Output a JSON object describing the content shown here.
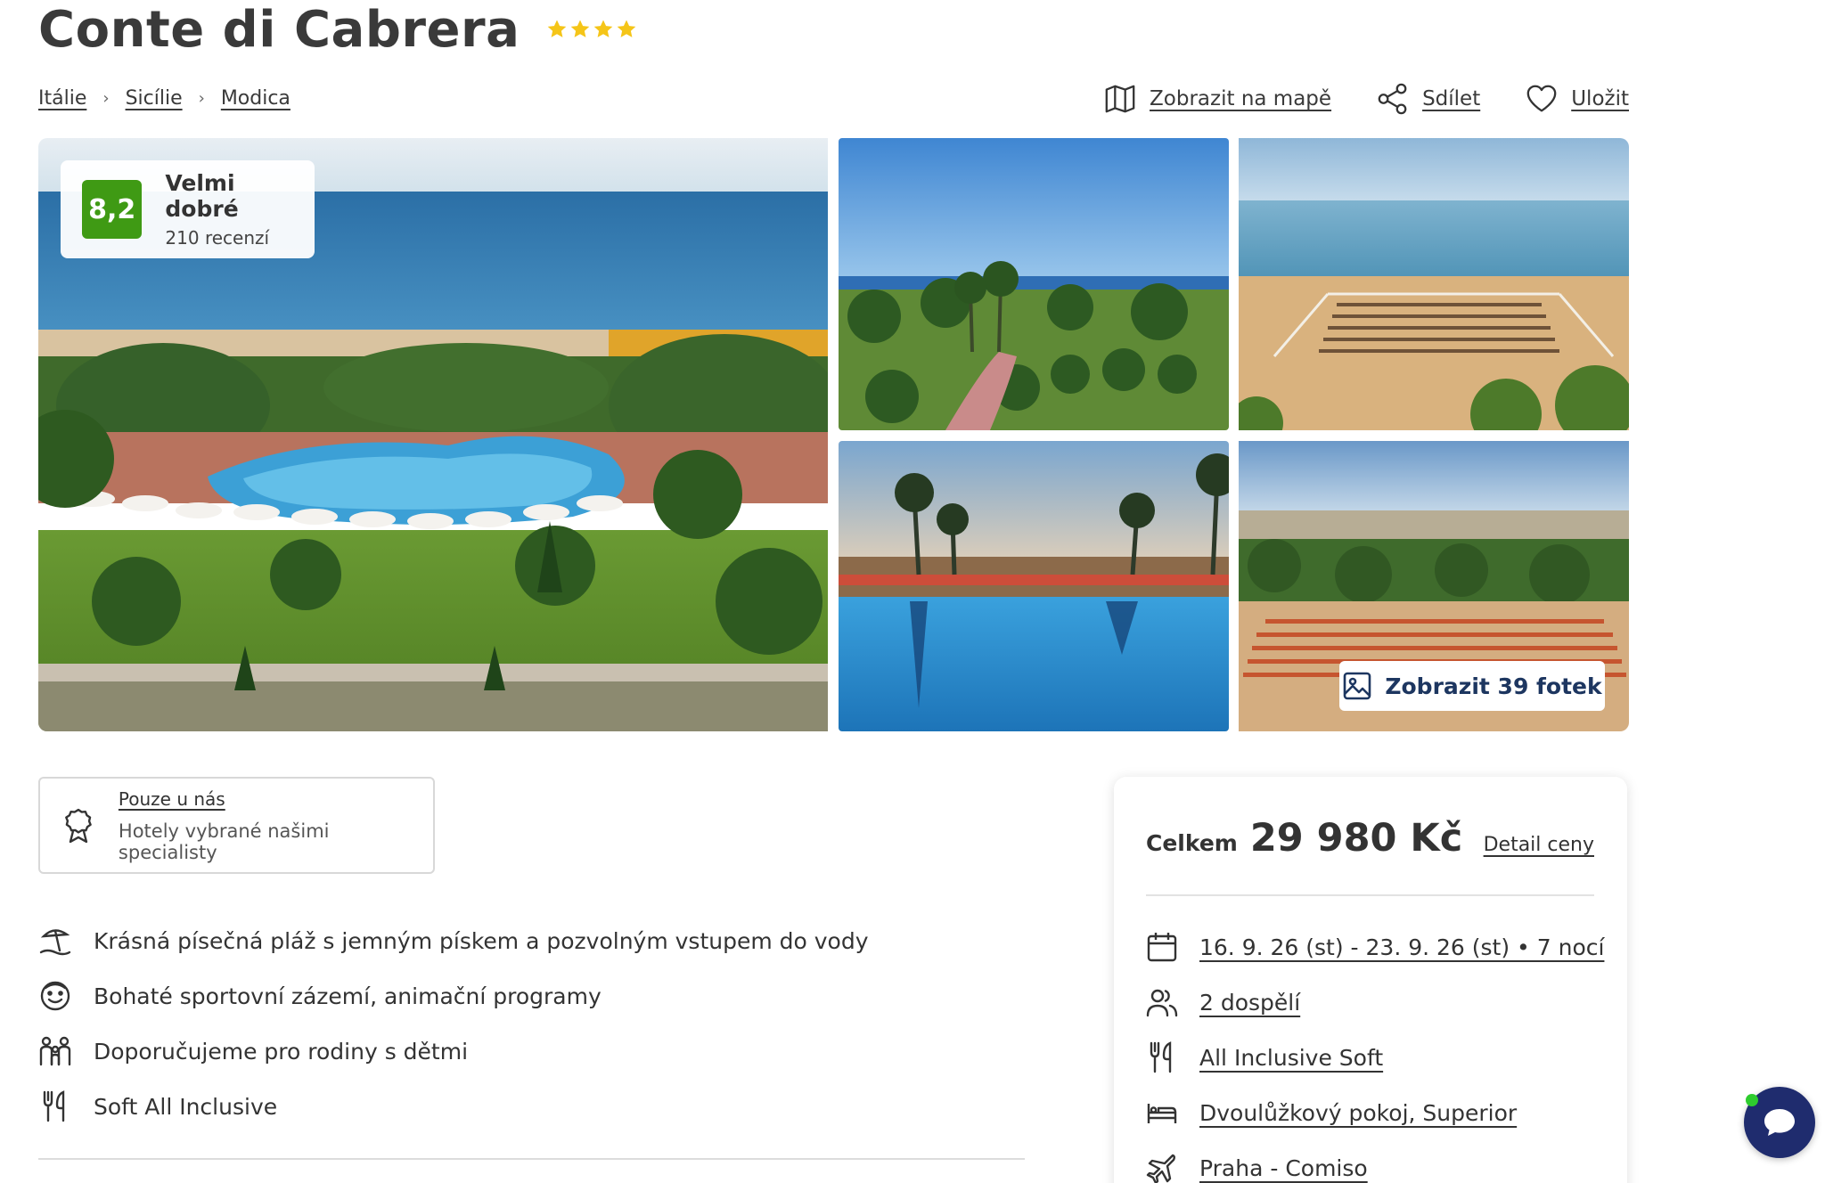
{
  "hotel": {
    "name": "Conte di Cabrera",
    "stars": 4
  },
  "breadcrumb": [
    "Itálie",
    "Sicílie",
    "Modica"
  ],
  "actions": {
    "map": "Zobrazit na mapě",
    "share": "Sdílet",
    "save": "Uložit"
  },
  "rating": {
    "score": "8,2",
    "label": "Velmi dobré",
    "count": "210 recenzí",
    "color": "#3f9a14"
  },
  "gallery": {
    "show_photos": "Zobrazit 39 fotek"
  },
  "exclusive": {
    "title": "Pouze u nás",
    "subtitle": "Hotely vybrané našimi specialisty"
  },
  "features": [
    {
      "icon": "beach-umbrella-icon",
      "text": "Krásná písečná pláž s jemným pískem a pozvolným vstupem do vody"
    },
    {
      "icon": "smiley-icon",
      "text": "Bohaté sportovní zázemí, animační programy"
    },
    {
      "icon": "family-icon",
      "text": "Doporučujeme pro rodiny s dětmi"
    },
    {
      "icon": "cutlery-icon",
      "text": "Soft All Inclusive"
    }
  ],
  "price": {
    "label": "Celkem",
    "amount": "29 980 Kč",
    "detail_link": "Detail ceny"
  },
  "trip": {
    "dates": "16. 9. 26 (st) - 23. 9. 26 (st) • 7 nocí",
    "travelers": "2 dospělí",
    "board": "All Inclusive Soft",
    "room": "Dvoulůžkový pokoj, Superior",
    "flight": "Praha - Comiso"
  },
  "colors": {
    "accent": "#1f2c6e",
    "star": "#f5c518",
    "rating": "#3f9a14"
  }
}
